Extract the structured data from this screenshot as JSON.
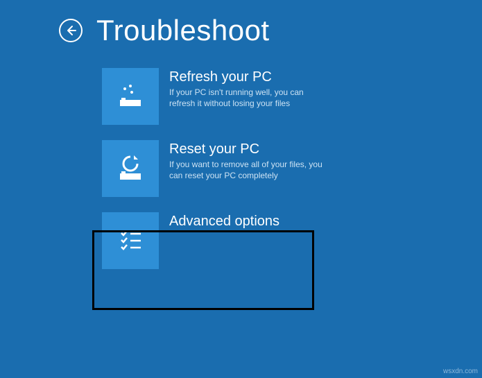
{
  "header": {
    "title": "Troubleshoot"
  },
  "options": [
    {
      "title": "Refresh your PC",
      "desc": "If your PC isn't running well, you can refresh it without losing your files"
    },
    {
      "title": "Reset your PC",
      "desc": "If you want to remove all of your files, you can reset your PC completely"
    },
    {
      "title": "Advanced options",
      "desc": ""
    }
  ],
  "watermark": "wsxdn.com"
}
